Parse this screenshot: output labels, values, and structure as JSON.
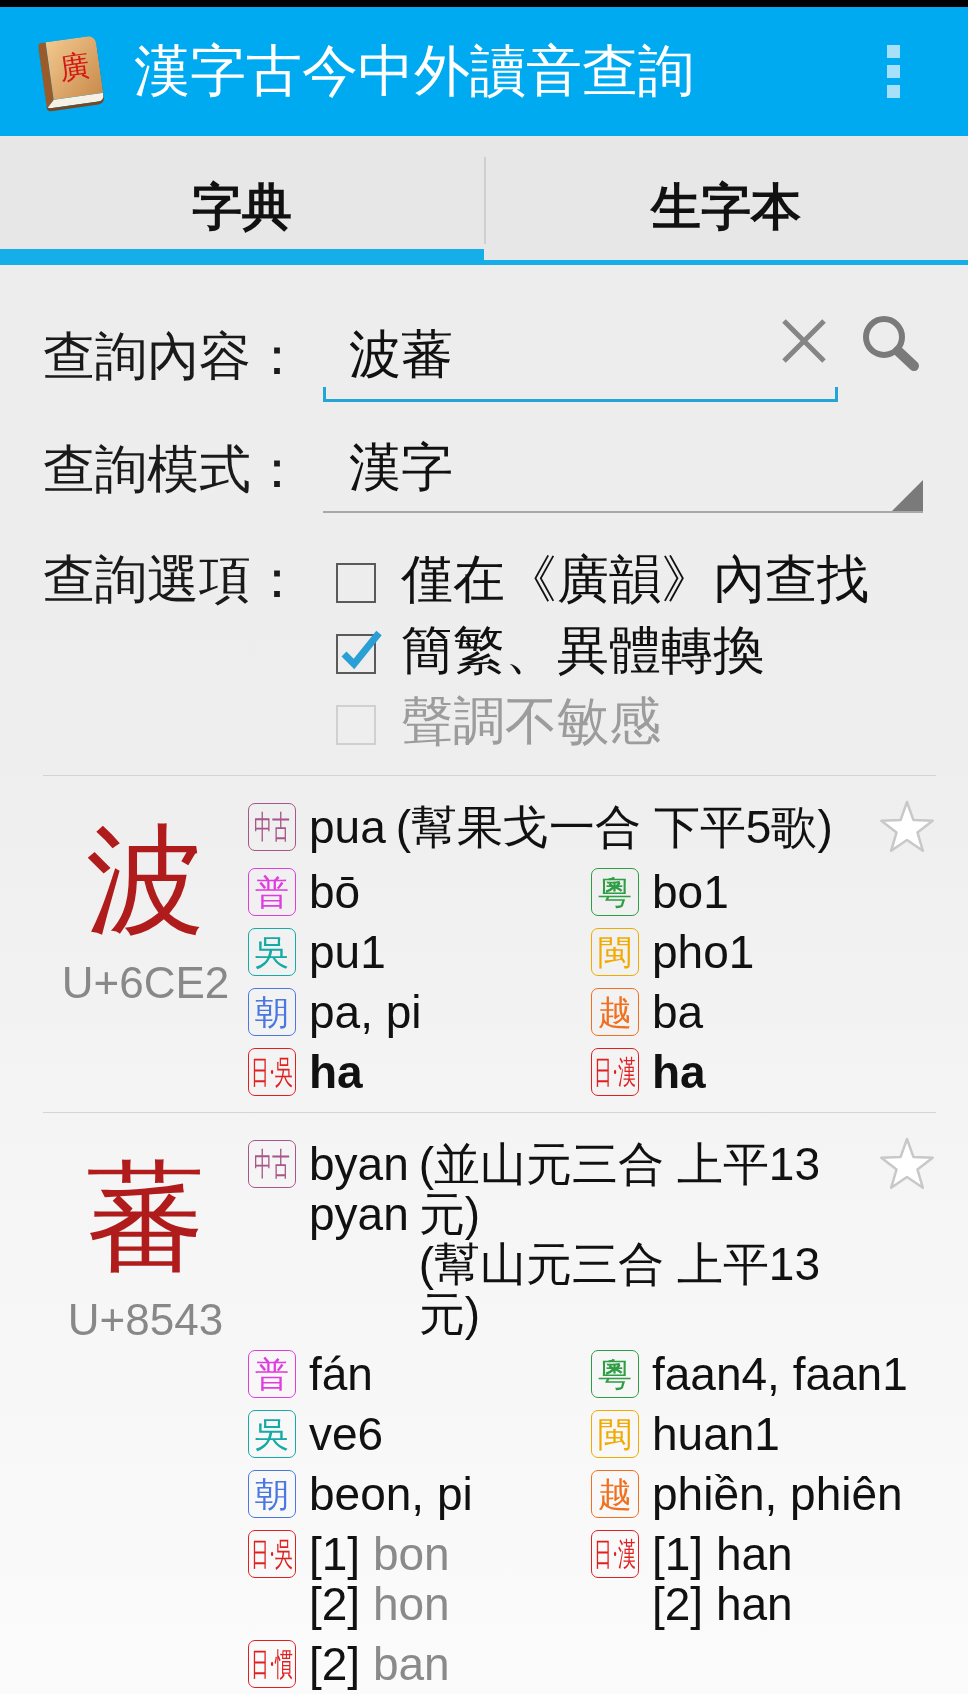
{
  "app_bar": {
    "logo_glyph": "廣",
    "title": "漢字古今中外讀音查詢"
  },
  "tabs": [
    {
      "label": "字典",
      "selected": true
    },
    {
      "label": "生字本",
      "selected": false
    }
  ],
  "search_form": {
    "query": {
      "label": "查詢內容：",
      "value": "波蕃"
    },
    "mode": {
      "label": "查詢模式：",
      "value": "漢字"
    },
    "options": {
      "label": "查詢選項：",
      "items": [
        {
          "label": "僅在《廣韻》內查找",
          "checked": false,
          "disabled": false
        },
        {
          "label": "簡繁、異體轉換",
          "checked": true,
          "disabled": false
        },
        {
          "label": "聲調不敏感",
          "checked": false,
          "disabled": true
        }
      ]
    }
  },
  "entries": [
    {
      "character": "波",
      "codepoint": "U+6CE2",
      "starred": false,
      "middle_chinese": {
        "label": "中古",
        "color": "#a8558a",
        "readings": [
          "pua"
        ],
        "notes": [
          "(幫果戈一合 下平5歌)"
        ]
      },
      "dialects": [
        {
          "label": "普",
          "color": "#e03ce0",
          "readings": [
            {
              "text": "bō",
              "kind": "regular"
            }
          ]
        },
        {
          "label": "粵",
          "color": "#2e9e44",
          "readings": [
            {
              "text": "bo1",
              "kind": "regular"
            }
          ]
        },
        {
          "label": "吳",
          "color": "#14aaa6",
          "readings": [
            {
              "text": "pu1",
              "kind": "regular"
            }
          ]
        },
        {
          "label": "閩",
          "color": "#f0aa00",
          "readings": [
            {
              "text": "pho1",
              "kind": "regular"
            }
          ]
        },
        {
          "label": "朝",
          "color": "#4a78e0",
          "readings": [
            {
              "text": "pa, pi",
              "kind": "regular"
            }
          ]
        },
        {
          "label": "越",
          "color": "#f07020",
          "readings": [
            {
              "text": "ba",
              "kind": "regular"
            }
          ]
        },
        {
          "label": "日·吳",
          "color": "#e02020",
          "readings": [
            {
              "text": "ha",
              "kind": "bold"
            }
          ]
        },
        {
          "label": "日·漢",
          "color": "#e02020",
          "readings": [
            {
              "text": "ha",
              "kind": "bold"
            }
          ]
        }
      ]
    },
    {
      "character": "蕃",
      "codepoint": "U+8543",
      "starred": false,
      "middle_chinese": {
        "label": "中古",
        "color": "#a8558a",
        "readings": [
          "byan",
          "pyan"
        ],
        "notes": [
          "(並山元三合 上平13元)",
          "(幫山元三合 上平13元)"
        ]
      },
      "dialects": [
        {
          "label": "普",
          "color": "#e03ce0",
          "readings": [
            {
              "text": "fán",
              "kind": "regular"
            }
          ]
        },
        {
          "label": "粵",
          "color": "#2e9e44",
          "readings": [
            {
              "text": "faan4, faan1",
              "kind": "regular"
            }
          ]
        },
        {
          "label": "吳",
          "color": "#14aaa6",
          "readings": [
            {
              "text": "ve6",
              "kind": "regular"
            }
          ]
        },
        {
          "label": "閩",
          "color": "#f0aa00",
          "readings": [
            {
              "text": "huan1",
              "kind": "regular"
            }
          ]
        },
        {
          "label": "朝",
          "color": "#4a78e0",
          "readings": [
            {
              "text": "beon, pi",
              "kind": "regular"
            }
          ]
        },
        {
          "label": "越",
          "color": "#f07020",
          "readings": [
            {
              "text": "phiền, phiên",
              "kind": "regular"
            }
          ]
        },
        {
          "label": "日·吳",
          "color": "#e02020",
          "readings": [
            {
              "index": "[1]",
              "text": "bon",
              "kind": "muted"
            },
            {
              "index": "[2]",
              "text": "hon",
              "kind": "muted"
            }
          ]
        },
        {
          "label": "日·漢",
          "color": "#e02020",
          "readings": [
            {
              "index": "[1]",
              "text": "han",
              "kind": "regular"
            },
            {
              "index": "[2]",
              "text": "han",
              "kind": "regular"
            }
          ]
        },
        {
          "label": "日·慣",
          "color": "#e02020",
          "readings": [
            {
              "index": "[2]",
              "text": "ban",
              "kind": "muted"
            }
          ]
        }
      ]
    }
  ]
}
